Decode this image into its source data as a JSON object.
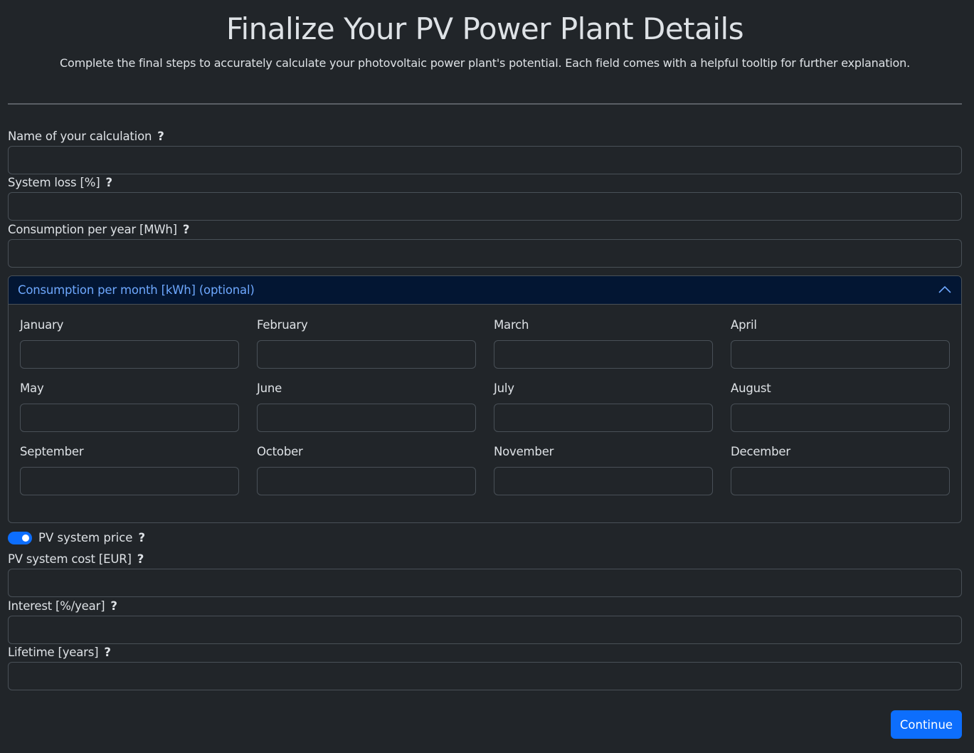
{
  "header": {
    "title": "Finalize Your PV Power Plant Details",
    "subtitle": "Complete the final steps to accurately calculate your photovoltaic power plant's potential. Each field comes with a helpful tooltip for further explanation."
  },
  "fields": {
    "name": {
      "label": "Name of your calculation",
      "value": ""
    },
    "system_loss": {
      "label": "System loss [%]",
      "value": ""
    },
    "consumption_year": {
      "label": "Consumption per year [MWh]",
      "value": ""
    },
    "pv_cost": {
      "label": "PV system cost [EUR]",
      "value": ""
    },
    "interest": {
      "label": "Interest [%/year]",
      "value": ""
    },
    "lifetime": {
      "label": "Lifetime [years]",
      "value": ""
    }
  },
  "help": "?",
  "accordion": {
    "title": "Consumption per month [kWh] (optional)",
    "expanded": true,
    "months": [
      "January",
      "February",
      "March",
      "April",
      "May",
      "June",
      "July",
      "August",
      "September",
      "October",
      "November",
      "December"
    ]
  },
  "toggle": {
    "label": "PV system price",
    "on": true
  },
  "continue_label": "Continue",
  "colors": {
    "accent": "#0d6efd",
    "accordion_header_bg": "#031633",
    "accordion_header_text": "#6ea8fe",
    "background": "#212529"
  }
}
